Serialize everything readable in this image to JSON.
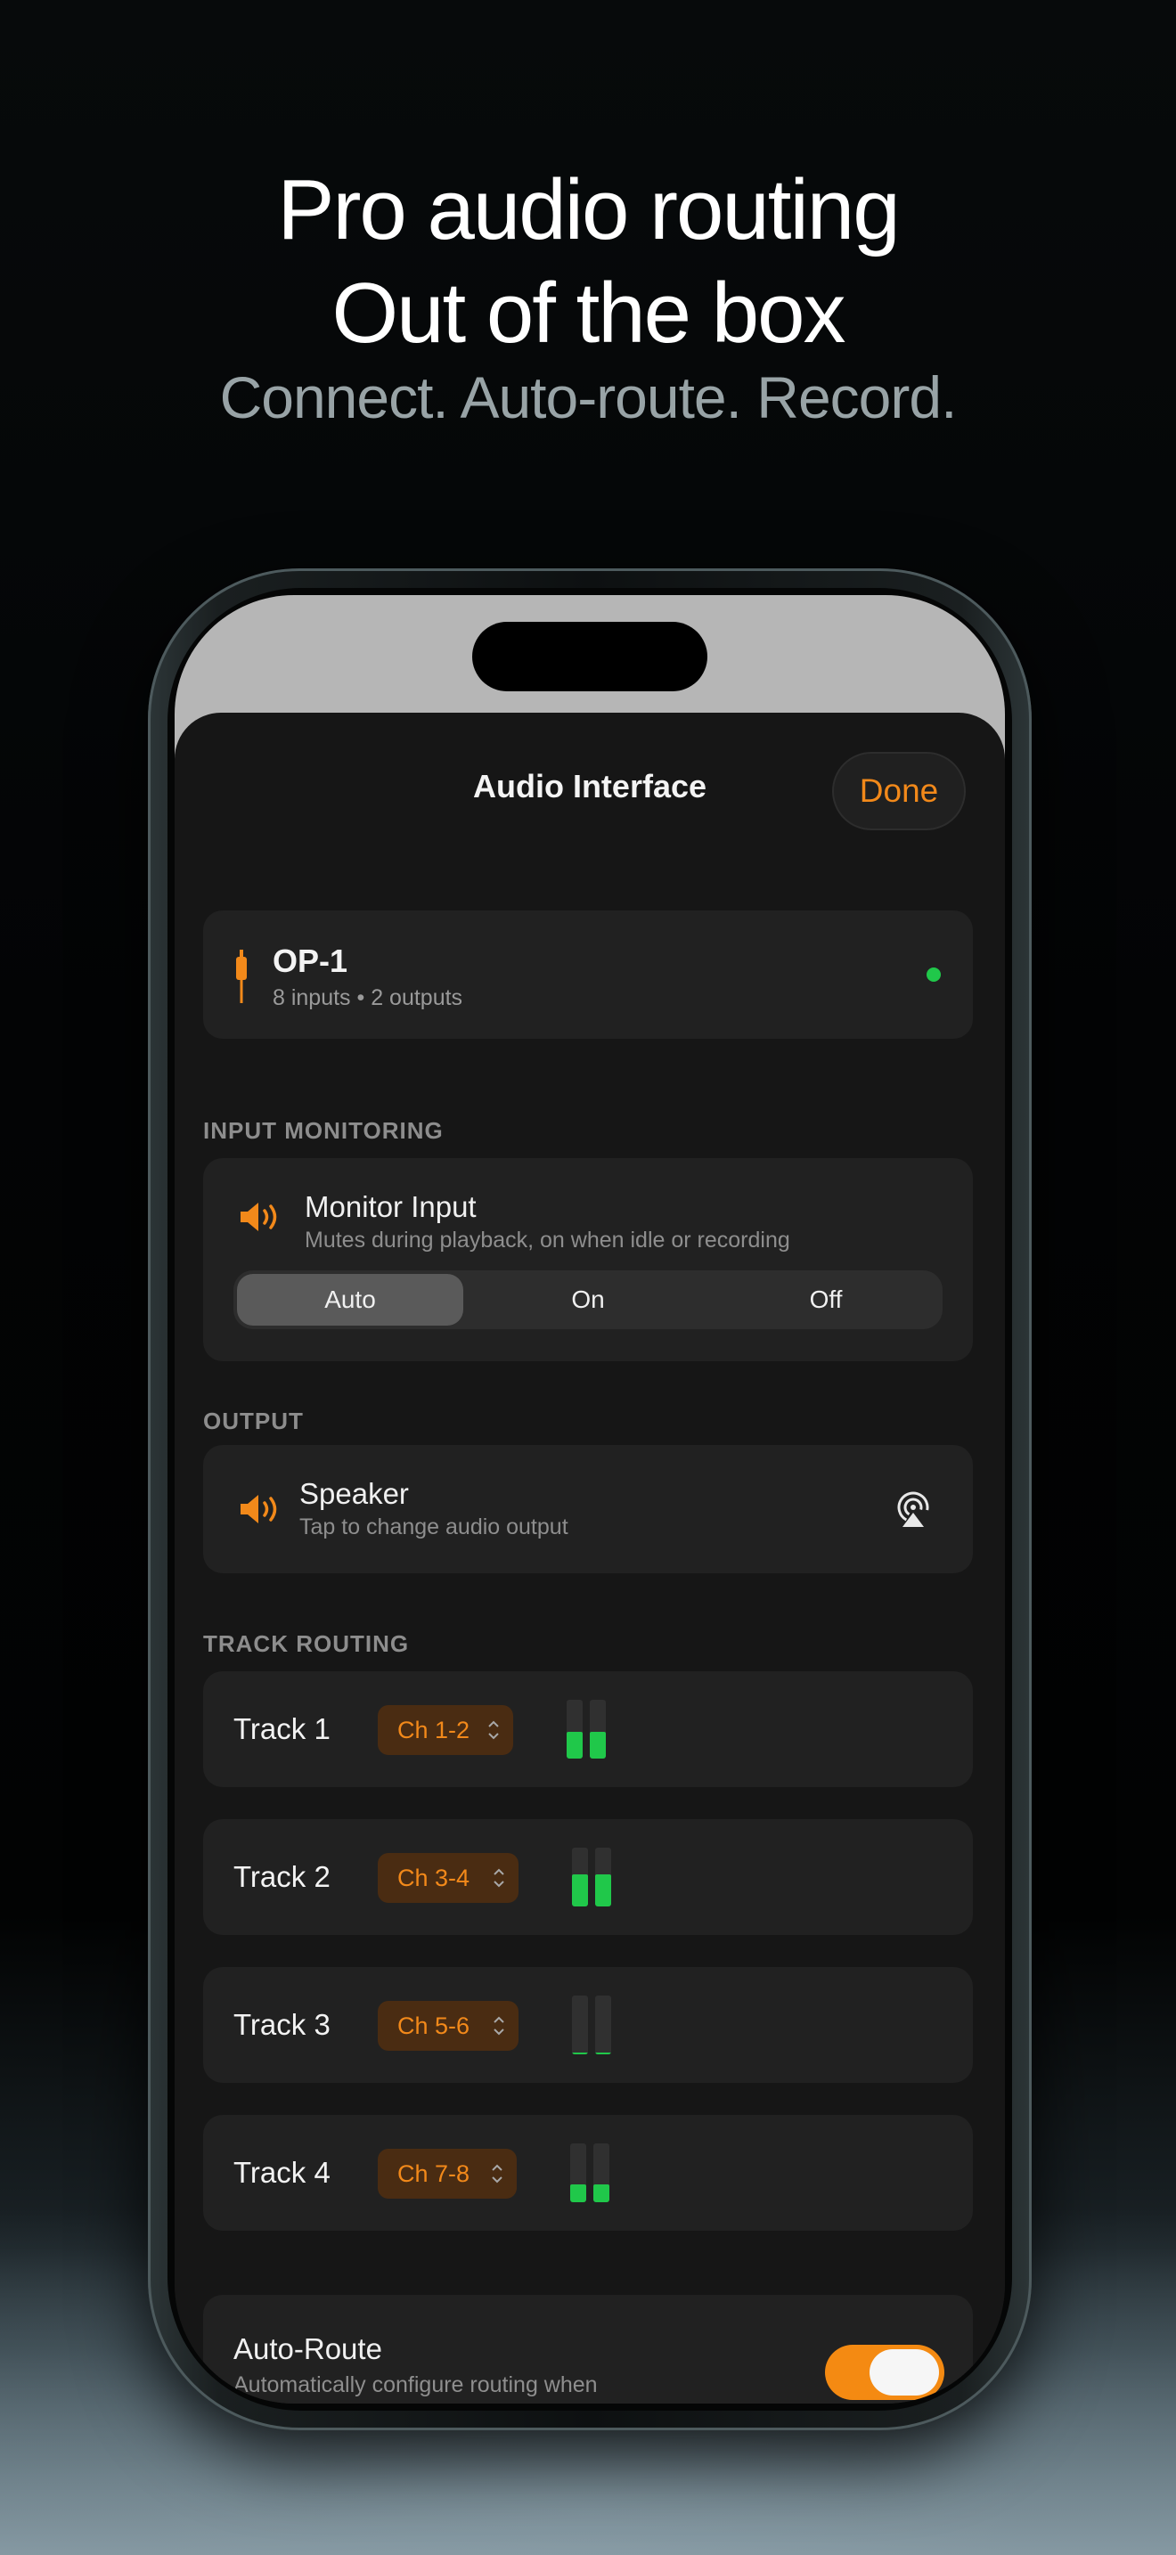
{
  "marketing": {
    "headline_line1": "Pro audio routing",
    "headline_line2": "Out of the box",
    "subheadline": "Connect. Auto-route. Record."
  },
  "sheet": {
    "title": "Audio Interface",
    "done_label": "Done"
  },
  "device": {
    "name": "OP-1",
    "detail": "8 inputs • 2 outputs",
    "connected": true,
    "status_color": "#20c84a"
  },
  "input_monitoring": {
    "section_label": "INPUT MONITORING",
    "title": "Monitor Input",
    "subtitle": "Mutes during playback, on when idle or recording",
    "options": [
      "Auto",
      "On",
      "Off"
    ],
    "selected": "Auto"
  },
  "output": {
    "section_label": "OUTPUT",
    "title": "Speaker",
    "subtitle": "Tap to change audio output",
    "icon": "airplay-icon"
  },
  "track_routing": {
    "section_label": "TRACK ROUTING",
    "tracks": [
      {
        "label": "Track 1",
        "channel": "Ch 1-2",
        "level_left": 0.45,
        "level_right": 0.45
      },
      {
        "label": "Track 2",
        "channel": "Ch 3-4",
        "level_left": 0.55,
        "level_right": 0.55
      },
      {
        "label": "Track 3",
        "channel": "Ch 5-6",
        "level_left": 0.02,
        "level_right": 0.02
      },
      {
        "label": "Track 4",
        "channel": "Ch 7-8",
        "level_left": 0.3,
        "level_right": 0.3
      }
    ]
  },
  "auto_route": {
    "title": "Auto-Route",
    "subtitle": "Automatically configure routing when interface connects",
    "enabled": true
  },
  "colors": {
    "accent": "#f2891a",
    "meter_green": "#20c84a",
    "card_bg": "#212121",
    "sheet_bg": "#161616"
  }
}
